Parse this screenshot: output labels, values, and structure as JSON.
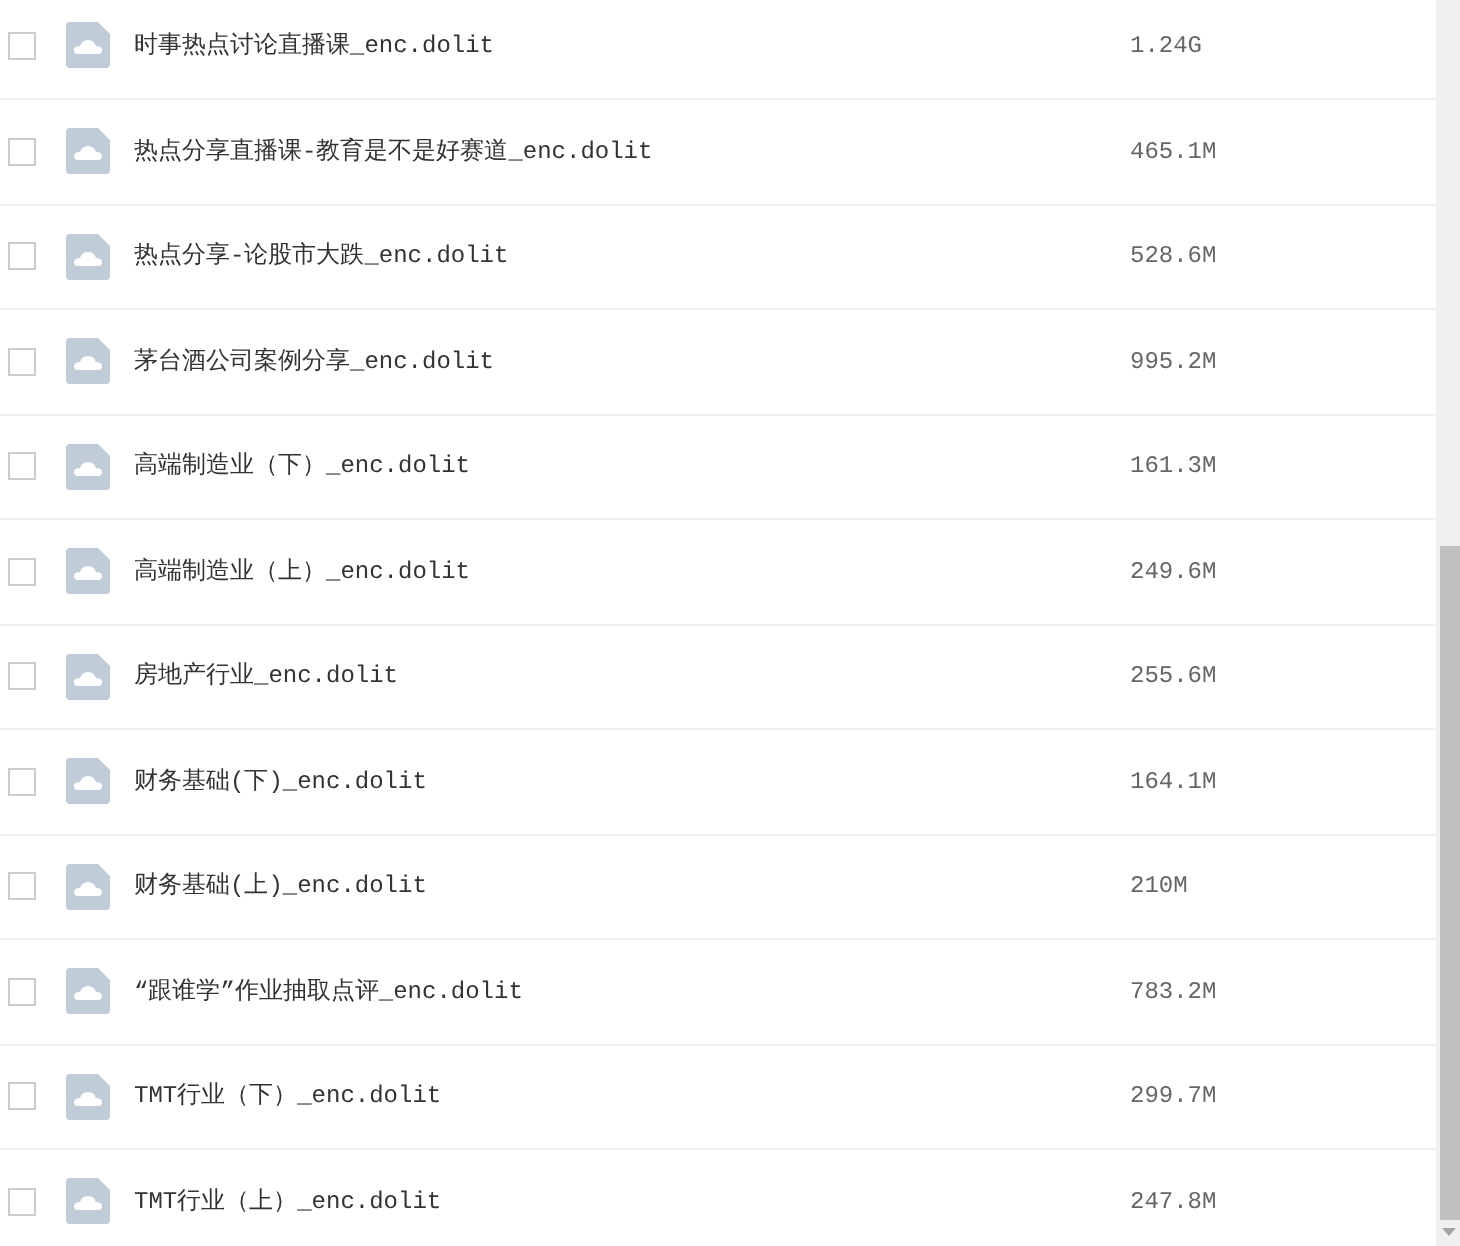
{
  "files": [
    {
      "name": "时事热点讨论直播课_enc.dolit",
      "size": "1.24G",
      "checked": false
    },
    {
      "name": "热点分享直播课-教育是不是好赛道_enc.dolit",
      "size": "465.1M",
      "checked": false
    },
    {
      "name": "热点分享-论股市大跌_enc.dolit",
      "size": "528.6M",
      "checked": false
    },
    {
      "name": "茅台酒公司案例分享_enc.dolit",
      "size": "995.2M",
      "checked": false
    },
    {
      "name": "高端制造业（下）_enc.dolit",
      "size": "161.3M",
      "checked": false
    },
    {
      "name": "高端制造业（上）_enc.dolit",
      "size": "249.6M",
      "checked": false
    },
    {
      "name": "房地产行业_enc.dolit",
      "size": "255.6M",
      "checked": false
    },
    {
      "name": "财务基础(下)_enc.dolit",
      "size": "164.1M",
      "checked": false
    },
    {
      "name": "财务基础(上)_enc.dolit",
      "size": "210M",
      "checked": false
    },
    {
      "name": "“跟谁学”作业抽取点评_enc.dolit",
      "size": "783.2M",
      "checked": false
    },
    {
      "name": "TMT行业（下）_enc.dolit",
      "size": "299.7M",
      "checked": false
    },
    {
      "name": "TMT行业（上）_enc.dolit",
      "size": "247.8M",
      "checked": false
    }
  ]
}
